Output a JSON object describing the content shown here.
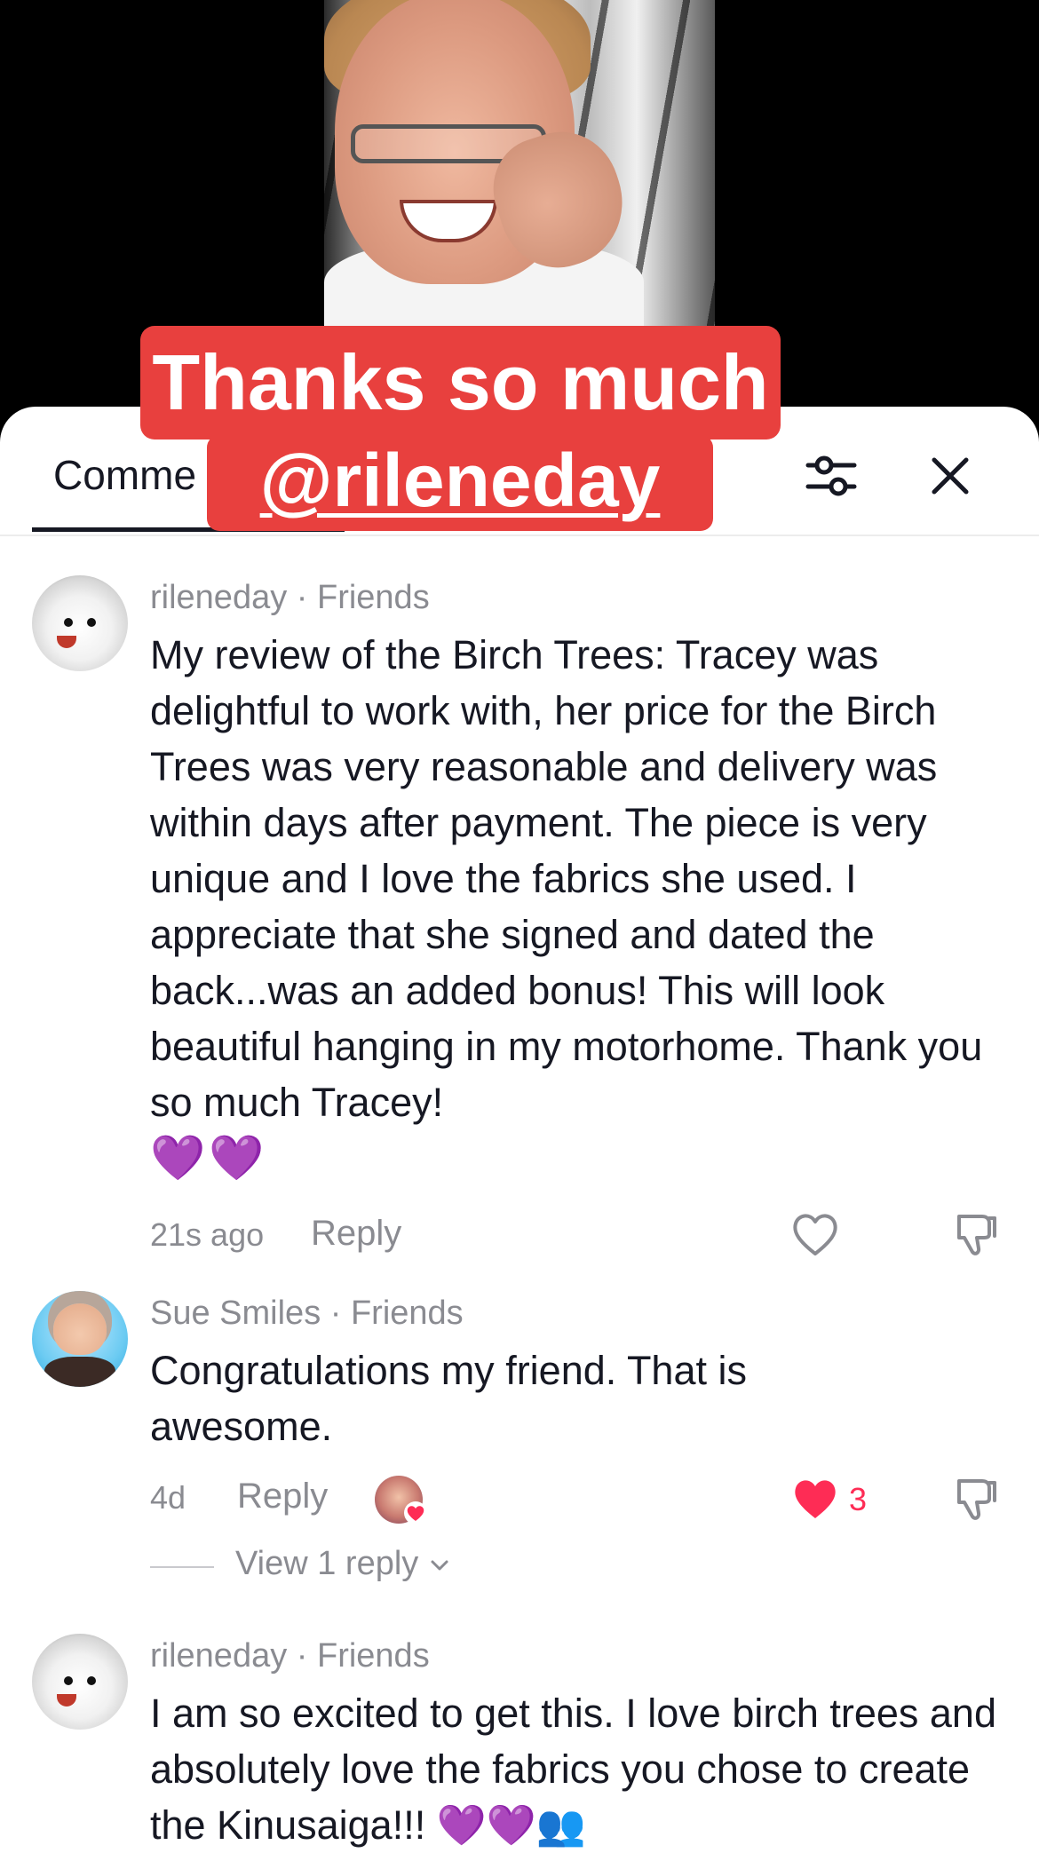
{
  "video": {
    "caption_line1": "Thanks so much",
    "caption_line2": "@rileneday"
  },
  "header": {
    "tab_label": "Comme",
    "filter_icon": "sliders-icon",
    "close_icon": "close-icon"
  },
  "comments": [
    {
      "author": "rileneday",
      "relation": "Friends",
      "meta": "rileneday · Friends",
      "text": "My review of the Birch Trees: Tracey was delightful to work with, her price for the Birch Trees was very reasonable and delivery was within days after payment. The piece is very unique and I love the fabrics she used. I appreciate that she signed and dated the back...was an added bonus! This will look beautiful hanging in my motorhome. Thank you so much Tracey!",
      "emoji": "💜💜",
      "time": "21s ago",
      "reply_label": "Reply"
    },
    {
      "author": "Sue Smiles",
      "relation": "Friends",
      "meta": "Sue Smiles · Friends",
      "text": "Congratulations my friend. That is awesome.",
      "time": "4d",
      "reply_label": "Reply",
      "like_count": "3",
      "liked": true,
      "view_replies": "View 1 reply"
    },
    {
      "author": "rileneday",
      "relation": "Friends",
      "meta": "rileneday · Friends",
      "text": "I am so excited to get this. I love birch trees and absolutely love the fabrics you chose to create the Kinusaiga!!! 💜💜👥"
    }
  ],
  "colors": {
    "caption_red": "#e8403e",
    "like_red": "#fe2c55",
    "meta_gray": "#8a8b91",
    "text_dark": "#161823"
  }
}
